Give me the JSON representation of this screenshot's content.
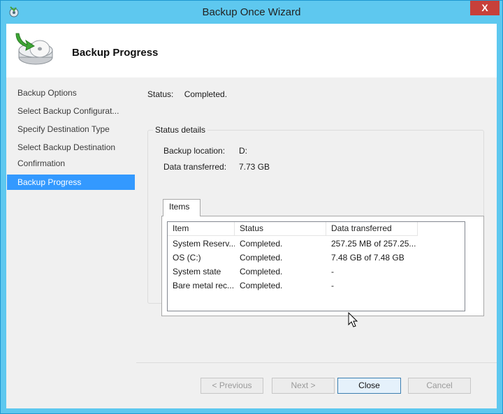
{
  "window": {
    "title": "Backup Once Wizard",
    "close_glyph": "X"
  },
  "header": {
    "title": "Backup Progress",
    "icon": "backup-disk-icon"
  },
  "nav": {
    "items": [
      {
        "label": "Backup Options"
      },
      {
        "label": "Select Backup Configurat..."
      },
      {
        "label": "Specify Destination Type"
      },
      {
        "label": "Select Backup Destination"
      },
      {
        "label": "Confirmation"
      },
      {
        "label": "Backup Progress",
        "active": true
      }
    ]
  },
  "status": {
    "label": "Status:",
    "value": "Completed."
  },
  "details": {
    "group_label": "Status details",
    "location_label": "Backup location:",
    "location_value": "D:",
    "transferred_label": "Data transferred:",
    "transferred_value": "7.73 GB"
  },
  "tab": {
    "label": "Items"
  },
  "table": {
    "columns": [
      "Item",
      "Status",
      "Data transferred"
    ],
    "rows": [
      [
        "System Reserv...",
        "Completed.",
        "257.25 MB of 257.25..."
      ],
      [
        "OS (C:)",
        "Completed.",
        "7.48 GB of 7.48 GB"
      ],
      [
        "System state",
        "Completed.",
        "-"
      ],
      [
        "Bare metal rec...",
        "Completed.",
        "-"
      ]
    ]
  },
  "buttons": {
    "previous": "< Previous",
    "next": "Next >",
    "close": "Close",
    "cancel": "Cancel"
  },
  "colors": {
    "accent": "#3399ff",
    "titlebar": "#5ec8ef",
    "close": "#c7403a"
  }
}
